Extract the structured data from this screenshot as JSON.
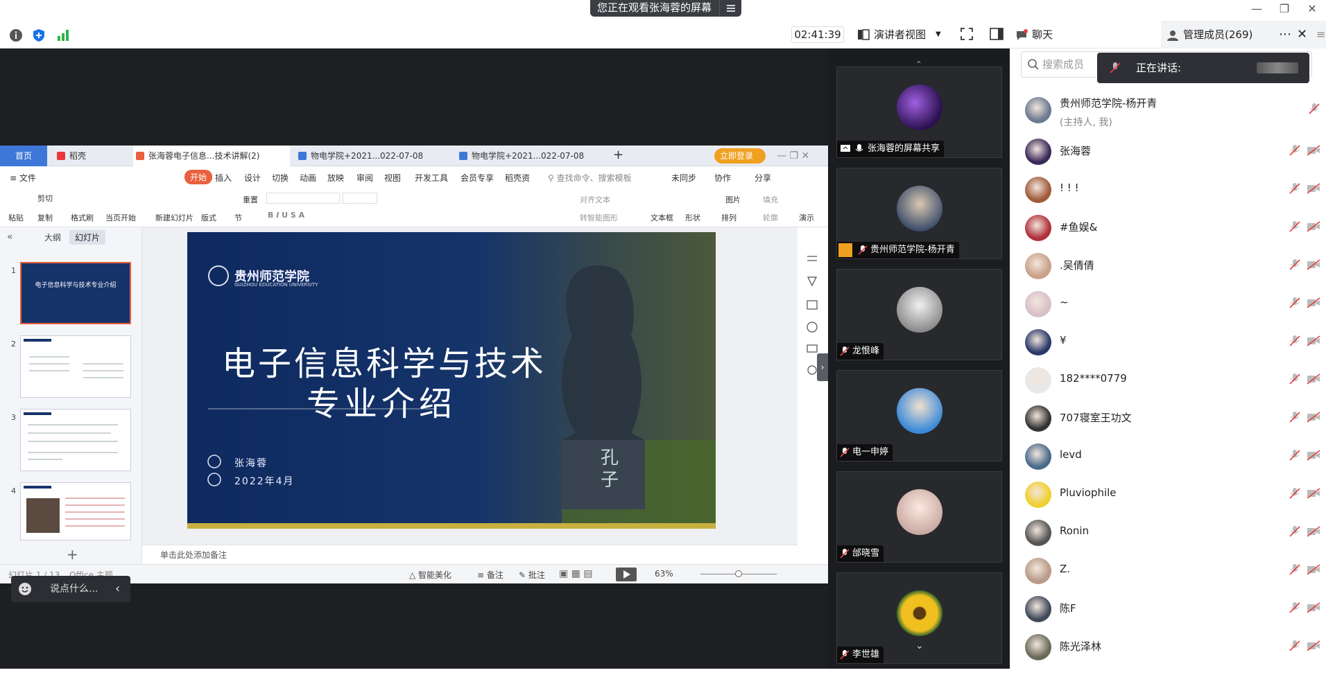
{
  "banner": {
    "text": "您正在观看张海蓉的屏幕"
  },
  "toolbar": {
    "timer": "02:41:39",
    "presenter_view": "演讲者视图"
  },
  "right_tabs": {
    "chat": "聊天",
    "members": "管理成员(269)"
  },
  "ppt": {
    "tabs": [
      "首页",
      "稻壳",
      "张海蓉电子信息...技术讲解(2)",
      "物电学院+2021...022-07-08",
      "物电学院+2021...022-07-08"
    ],
    "login": "立即登录",
    "menu": [
      "文件",
      "开始",
      "插入",
      "设计",
      "切换",
      "动画",
      "放映",
      "审阅",
      "视图",
      "开发工具",
      "会员专享",
      "稻壳资"
    ],
    "search_placeholder": "查找命令、搜索模板",
    "unsync": "未同步",
    "collab": "协作",
    "share": "分享",
    "ribbon": [
      "粘贴",
      "剪切",
      "复制",
      "格式刷",
      "当页开始",
      "新建幻灯片",
      "版式",
      "节",
      "重置",
      "文本框",
      "形状",
      "排列",
      "图片",
      "轮廓",
      "填充",
      "对齐文本",
      "转智能图形",
      "演示"
    ],
    "pane_tabs": [
      "大纲",
      "幻灯片"
    ],
    "thumb_numbers": [
      "1",
      "2",
      "3",
      "4"
    ],
    "thumb1_title": "电子信息科学与技术专业介绍",
    "slide": {
      "logo_cn": "贵州师范学院",
      "logo_en": "GUIZHOU EDUCATION UNIVERSITY",
      "title1": "电子信息科学与技术",
      "title2": "专业介绍",
      "author": "张海蓉",
      "date": "2022年4月",
      "statue_text": "孔子"
    },
    "notes": "单击此处添加备注",
    "status": {
      "slide_count": "幻灯片 1 / 13",
      "theme": "Office 主题",
      "beautify": "智能美化",
      "notes_btn": "备注",
      "comment": "批注",
      "zoom": "63%"
    }
  },
  "chat_input": {
    "placeholder": "说点什么..."
  },
  "video_tiles": [
    {
      "name": "张海蓉的屏幕共享"
    },
    {
      "name": "贵州师范学院-杨开青"
    },
    {
      "name": "龙恨峰"
    },
    {
      "name": "电一申婷"
    },
    {
      "name": "邰晓雪"
    },
    {
      "name": "李世雄"
    }
  ],
  "members_panel": {
    "search_placeholder": "搜索成员",
    "speaking": "正在讲话:",
    "members": [
      {
        "name": "贵州师范学院-杨开青",
        "sub": "(主持人, 我)",
        "color": "#6b7a8f"
      },
      {
        "name": "张海蓉",
        "color": "#3a2a5a"
      },
      {
        "name": "! ! !",
        "color": "#a05a3a"
      },
      {
        "name": "#鱼娱&",
        "color": "#b0303a"
      },
      {
        "name": ".吴倩倩",
        "color": "#c9a08a"
      },
      {
        "name": "~",
        "color": "#d8c0c8"
      },
      {
        "name": "¥",
        "color": "#2a3a6a"
      },
      {
        "name": "182****0779",
        "color": "#e8e8e8"
      },
      {
        "name": "707寝室王功文",
        "color": "#333333"
      },
      {
        "name": "levd",
        "color": "#4a6a8a"
      },
      {
        "name": "Pluviophile",
        "color": "#f0d030"
      },
      {
        "name": "Ronin",
        "color": "#555555"
      },
      {
        "name": "Z.",
        "color": "#b89a88"
      },
      {
        "name": "陈F",
        "color": "#404a5a"
      },
      {
        "name": "陈光泽林",
        "color": "#6a6a5a"
      }
    ]
  },
  "colors": {
    "accent": "#1a73e8",
    "ppt_tab_active": "#e8ecf2",
    "mute_red": "#e04040",
    "stage": "#1e1f22",
    "slide_bg": "#0f2a5c",
    "login": "#f0a020"
  }
}
